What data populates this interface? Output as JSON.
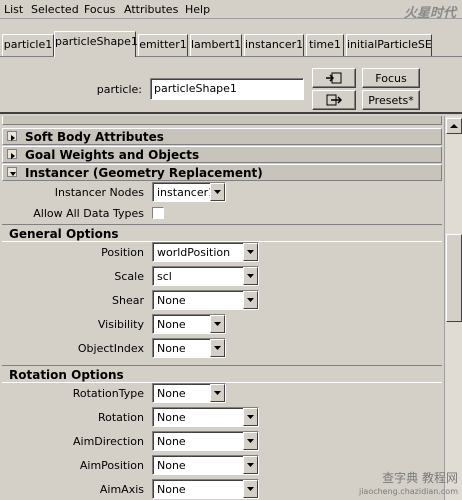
{
  "menu": {
    "items": [
      "List",
      "Selected",
      "Focus",
      "Attributes",
      "Help"
    ]
  },
  "watermark": "火星时代",
  "tabs": [
    "particle1",
    "particleShape1",
    "emitter1",
    "lambert1",
    "instancer1",
    "time1",
    "initialParticleSE"
  ],
  "top_panel": {
    "node_label": "particle:",
    "node_value": "particleShape1",
    "focus_label": "Focus",
    "presets_label": "Presets*"
  },
  "sections": {
    "soft_body": "Soft Body Attributes",
    "goal_weights": "Goal Weights and Objects",
    "instancer": "Instancer (Geometry Replacement)"
  },
  "instancer": {
    "nodes_label": "Instancer Nodes",
    "nodes_value": "instancer1",
    "allow_all_label": "Allow All Data Types"
  },
  "general_options": {
    "title": "General Options",
    "rows": [
      {
        "label": "Position",
        "value": "worldPosition"
      },
      {
        "label": "Scale",
        "value": "scl"
      },
      {
        "label": "Shear",
        "value": "None"
      },
      {
        "label": "Visibility",
        "value": "None"
      },
      {
        "label": "ObjectIndex",
        "value": "None"
      }
    ]
  },
  "rotation_options": {
    "title": "Rotation Options",
    "rows": [
      {
        "label": "RotationType",
        "value": "None"
      },
      {
        "label": "Rotation",
        "value": "None"
      },
      {
        "label": "AimDirection",
        "value": "None"
      },
      {
        "label": "AimPosition",
        "value": "None"
      },
      {
        "label": "AimAxis",
        "value": "None"
      }
    ]
  },
  "footer_watermark": {
    "line1": "查字典 教程网",
    "line2": "jiaocheng.chazidian.com"
  }
}
